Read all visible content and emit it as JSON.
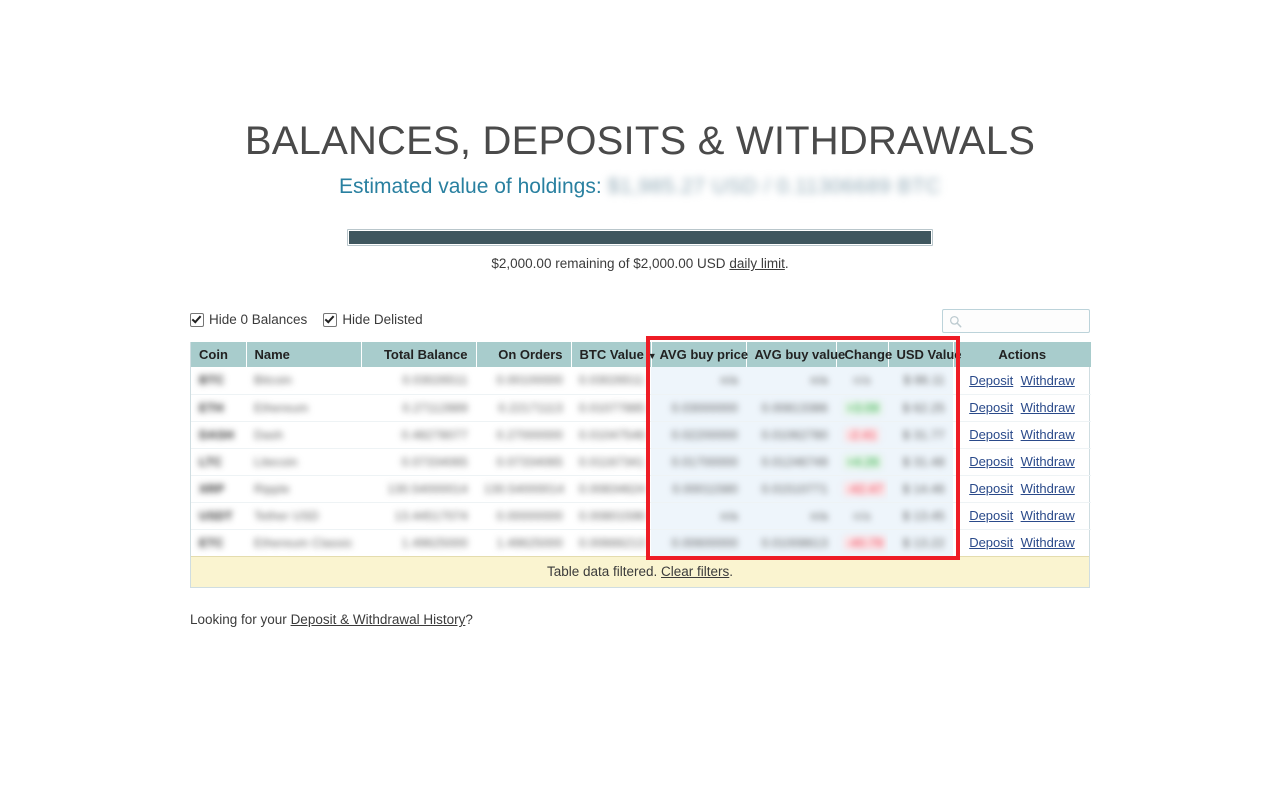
{
  "header": {
    "title": "BALANCES, DEPOSITS & WITHDRAWALS",
    "holdings_label": "Estimated value of holdings:",
    "holdings_value": "$1,985.27 USD / 0.11306689 BTC"
  },
  "limit": {
    "progress_percent": 100,
    "text_before": "$2,000.00 remaining of $2,000.00 USD",
    "link": "daily limit",
    "text_after": "."
  },
  "controls": {
    "hide_zero_balances": "Hide 0 Balances",
    "hide_zero_balances_checked": true,
    "hide_delisted": "Hide Delisted",
    "hide_delisted_checked": true,
    "search_value": "",
    "search_placeholder": "",
    "search_icon": "search-icon"
  },
  "table": {
    "columns": [
      {
        "label": "Coin",
        "align": "ta-l",
        "highlight": false
      },
      {
        "label": "Name",
        "align": "ta-l",
        "highlight": false
      },
      {
        "label": "Total Balance",
        "align": "ta-r",
        "highlight": false
      },
      {
        "label": "On Orders",
        "align": "ta-r",
        "highlight": false
      },
      {
        "label": "BTC Value",
        "align": "ta-r",
        "highlight": false,
        "sort": "desc"
      },
      {
        "label": "AVG buy price",
        "align": "ta-r",
        "highlight": true
      },
      {
        "label": "AVG buy value",
        "align": "ta-r",
        "highlight": true
      },
      {
        "label": "Change",
        "align": "ta-c",
        "highlight": true
      },
      {
        "label": "USD Value",
        "align": "ta-r",
        "highlight": true
      },
      {
        "label": "Actions",
        "align": "ta-c",
        "highlight": false
      }
    ],
    "rows": [
      {
        "symbol": "BTC",
        "name": "Bitcoin",
        "total_balance": "0.03026511",
        "on_orders": "0.00100000",
        "btc_value": "0.03026511",
        "avg_buy_price": "n/a",
        "avg_buy_value": "n/a",
        "change": "n/a",
        "change_dir": "na",
        "usd_value": "$ 86.11"
      },
      {
        "symbol": "ETH",
        "name": "Ethereum",
        "total_balance": "0.27112889",
        "on_orders": "0.22171113",
        "btc_value": "0.01077885",
        "avg_buy_price": "0.03000000",
        "avg_buy_value": "0.00813386",
        "change": "+3.09",
        "change_dir": "pos",
        "usd_value": "$ 62.25"
      },
      {
        "symbol": "DASH",
        "name": "Dash",
        "total_balance": "0.48278077",
        "on_orders": "0.27000000",
        "btc_value": "0.01047546",
        "avg_buy_price": "0.02200000",
        "avg_buy_value": "0.01062780",
        "change": "-2.41",
        "change_dir": "neg",
        "usd_value": "$ 31.77"
      },
      {
        "symbol": "LTC",
        "name": "Litecoin",
        "total_balance": "0.07334065",
        "on_orders": "0.07334065",
        "btc_value": "0.01167341",
        "avg_buy_price": "0.01700000",
        "avg_buy_value": "0.01246749",
        "change": "+4.26",
        "change_dir": "pos",
        "usd_value": "$ 31.48"
      },
      {
        "symbol": "XRP",
        "name": "Ripple",
        "total_balance": "130.54000014",
        "on_orders": "130.54000014",
        "btc_value": "0.00834624",
        "avg_buy_price": "0.00011580",
        "avg_buy_value": "0.01510771",
        "change": "-42.47",
        "change_dir": "neg",
        "usd_value": "$ 14.46"
      },
      {
        "symbol": "USDT",
        "name": "Tether USD",
        "total_balance": "13.44517074",
        "on_orders": "0.00000000",
        "btc_value": "0.00801596",
        "avg_buy_price": "n/a",
        "avg_buy_value": "n/a",
        "change": "n/a",
        "change_dir": "na",
        "usd_value": "$ 13.45"
      },
      {
        "symbol": "ETC",
        "name": "Ethereum Classic",
        "total_balance": "1.49625000",
        "on_orders": "1.49625000",
        "btc_value": "0.00666213",
        "avg_buy_price": "0.00600000",
        "avg_buy_value": "0.01008613",
        "change": "-40.79",
        "change_dir": "neg",
        "usd_value": "$ 13.22"
      }
    ],
    "action_deposit": "Deposit",
    "action_withdraw": "Withdraw",
    "footer_text": "Table data filtered.",
    "footer_link": "Clear filters",
    "footer_suffix": "."
  },
  "after_table": {
    "prefix": "Looking for your ",
    "link": "Deposit & Withdrawal History",
    "suffix": "?"
  },
  "annotation": {
    "box_color": "#ee1c25",
    "covers_columns": [
      "AVG buy price",
      "AVG buy value",
      "Change",
      "USD Value"
    ]
  }
}
